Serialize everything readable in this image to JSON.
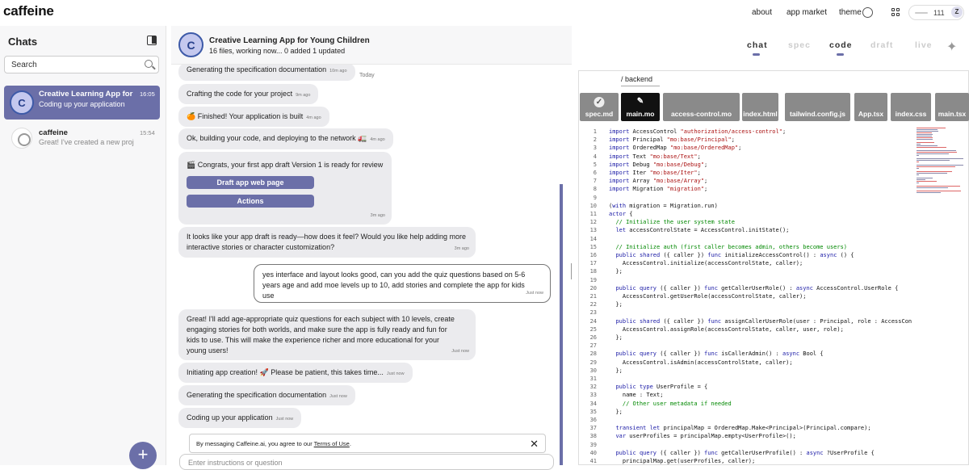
{
  "topbar": {
    "logo": "caffeine",
    "about": "about",
    "app_market": "app market",
    "theme": "theme",
    "credits": "111",
    "user_initial": "Z"
  },
  "sidebar": {
    "title": "Chats",
    "search_placeholder": "Search",
    "items": [
      {
        "avatar": "C",
        "title": "Creative Learning App for ...",
        "subtitle": "Coding up your application",
        "time": "16:05",
        "active": true
      },
      {
        "avatar": "",
        "title": "caffeine",
        "subtitle": "Great! I've created a new proj",
        "time": "15:54",
        "active": false
      }
    ]
  },
  "chat": {
    "avatar": "C",
    "title": "Creative Learning App for Young Children",
    "subtitle": "16 files,  working now... 0 added 1 updated",
    "today": "Today",
    "messages": [
      {
        "text": "Generating the specification documentation",
        "time": "10m ago"
      },
      {
        "text": "Crafting the code for your project",
        "time": "9m ago"
      },
      {
        "text": "🍊 Finished! Your application is built",
        "time": "4m ago"
      },
      {
        "text": "Ok, building your code, and deploying to the network 🚛",
        "time": "4m ago"
      },
      {
        "text": "🎬 Congrats, your first app draft Version 1 is ready for review",
        "time": "3m ago",
        "buttons": [
          "Draft app web page",
          "Actions"
        ]
      },
      {
        "text": "It looks like your app draft is ready—how does it feel? Would you like help adding more interactive stories or character customization?",
        "time": "3m ago"
      },
      {
        "text": "yes interface and layout looks good, can you add the quiz questions based on 5-6 years age and add moe levels up to 10, add stories and complete the app for kids use",
        "time": "Just now",
        "user": true
      },
      {
        "text": "Great! I'll add age-appropriate quiz questions for each subject with 10 levels, create engaging stories for both worlds, and make sure the app is fully ready and fun for kids to use. This will make the experience richer and more educational for your young users!",
        "time": "Just now"
      },
      {
        "text": "Initiating app creation! 🚀 Please be patient, this takes time...",
        "time": "Just now"
      },
      {
        "text": "Generating the specification documentation",
        "time": "Just now"
      },
      {
        "text": "Coding up your application",
        "time": "Just now"
      }
    ],
    "notice_prefix": "By messaging Caffeine.ai, you agree to our ",
    "notice_link": "Terms of Use",
    "notice_suffix": ".",
    "input_placeholder": "Enter instructions or question",
    "fab": "+"
  },
  "tabs": [
    {
      "label": "chat",
      "active": true
    },
    {
      "label": "spec",
      "active": false
    },
    {
      "label": "code",
      "active": true
    },
    {
      "label": "draft",
      "active": false
    },
    {
      "label": "live",
      "active": false
    }
  ],
  "code": {
    "crumb": "/ backend",
    "files": [
      {
        "label": "spec.md",
        "icon": "check"
      },
      {
        "label": "main.mo",
        "icon": "pencil",
        "active": true
      },
      {
        "label": "access-control.mo"
      },
      {
        "label": "index.html"
      },
      {
        "label": "tailwind.config.js"
      },
      {
        "label": "App.tsx"
      },
      {
        "label": "index.css"
      },
      {
        "label": "main.tsx"
      }
    ],
    "lines": [
      "import AccessControl \"authorization/access-control\";",
      "import Principal \"mo:base/Principal\";",
      "import OrderedMap \"mo:base/OrderedMap\";",
      "import Text \"mo:base/Text\";",
      "import Debug \"mo:base/Debug\";",
      "import Iter \"mo:base/Iter\";",
      "import Array \"mo:base/Array\";",
      "import Migration \"migration\";",
      "",
      "(with migration = Migration.run)",
      "actor {",
      "  // Initialize the user system state",
      "  let accessControlState = AccessControl.initState();",
      "",
      "  // Initialize auth (first caller becomes admin, others become users)",
      "  public shared ({ caller }) func initializeAccessControl() : async () {",
      "    AccessControl.initialize(accessControlState, caller);",
      "  };",
      "",
      "  public query ({ caller }) func getCallerUserRole() : async AccessControl.UserRole {",
      "    AccessControl.getUserRole(accessControlState, caller);",
      "  };",
      "",
      "  public shared ({ caller }) func assignCallerUserRole(user : Principal, role : AccessCon",
      "    AccessControl.assignRole(accessControlState, caller, user, role);",
      "  };",
      "",
      "  public query ({ caller }) func isCallerAdmin() : async Bool {",
      "    AccessControl.isAdmin(accessControlState, caller);",
      "  };",
      "",
      "  public type UserProfile = {",
      "    name : Text;",
      "    // Other user metadata if needed",
      "  };",
      "",
      "  transient let principalMap = OrderedMap.Make<Principal>(Principal.compare);",
      "  var userProfiles = principalMap.empty<UserProfile>();",
      "",
      "  public query ({ caller }) func getCallerUserProfile() : async ?UserProfile {",
      "    principalMap.get(userProfiles, caller);"
    ]
  }
}
